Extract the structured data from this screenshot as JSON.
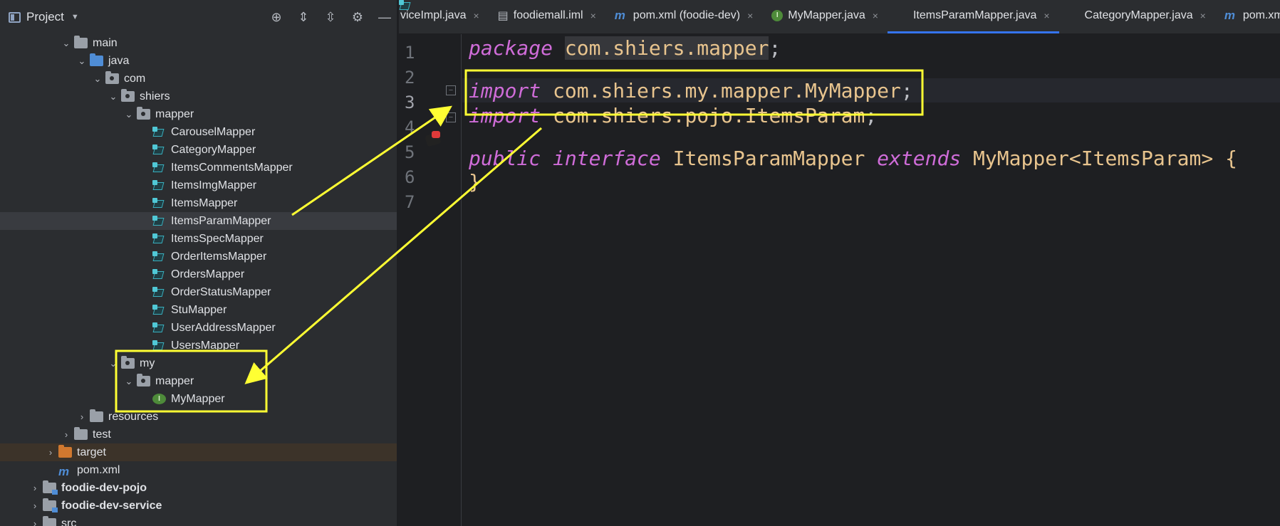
{
  "project_panel": {
    "title": "Project",
    "tree": [
      {
        "label": "main",
        "indent": 3,
        "expanded": true,
        "icon": "folder"
      },
      {
        "label": "java",
        "indent": 4,
        "expanded": true,
        "icon": "folder-blue"
      },
      {
        "label": "com",
        "indent": 5,
        "expanded": true,
        "icon": "package"
      },
      {
        "label": "shiers",
        "indent": 6,
        "expanded": true,
        "icon": "package"
      },
      {
        "label": "mapper",
        "indent": 7,
        "expanded": true,
        "icon": "package"
      },
      {
        "label": "CarouselMapper",
        "indent": 8,
        "icon": "mapper"
      },
      {
        "label": "CategoryMapper",
        "indent": 8,
        "icon": "mapper"
      },
      {
        "label": "ItemsCommentsMapper",
        "indent": 8,
        "icon": "mapper"
      },
      {
        "label": "ItemsImgMapper",
        "indent": 8,
        "icon": "mapper"
      },
      {
        "label": "ItemsMapper",
        "indent": 8,
        "icon": "mapper"
      },
      {
        "label": "ItemsParamMapper",
        "indent": 8,
        "icon": "mapper",
        "selected": true
      },
      {
        "label": "ItemsSpecMapper",
        "indent": 8,
        "icon": "mapper"
      },
      {
        "label": "OrderItemsMapper",
        "indent": 8,
        "icon": "mapper"
      },
      {
        "label": "OrdersMapper",
        "indent": 8,
        "icon": "mapper"
      },
      {
        "label": "OrderStatusMapper",
        "indent": 8,
        "icon": "mapper"
      },
      {
        "label": "StuMapper",
        "indent": 8,
        "icon": "mapper"
      },
      {
        "label": "UserAddressMapper",
        "indent": 8,
        "icon": "mapper"
      },
      {
        "label": "UsersMapper",
        "indent": 8,
        "icon": "mapper"
      },
      {
        "label": "my",
        "indent": 6,
        "expanded": true,
        "icon": "package"
      },
      {
        "label": "mapper",
        "indent": 7,
        "expanded": true,
        "icon": "package"
      },
      {
        "label": "MyMapper",
        "indent": 8,
        "icon": "interface"
      },
      {
        "label": "resources",
        "indent": 4,
        "collapsed": true,
        "icon": "folder"
      },
      {
        "label": "test",
        "indent": 3,
        "collapsed": true,
        "icon": "folder"
      },
      {
        "label": "target",
        "indent": 2,
        "collapsed": true,
        "icon": "folder-orange",
        "excluded": true
      },
      {
        "label": "pom.xml",
        "indent": 2,
        "icon": "maven"
      },
      {
        "label": "foodie-dev-pojo",
        "indent": 1,
        "collapsed": true,
        "icon": "module",
        "bold": true
      },
      {
        "label": "foodie-dev-service",
        "indent": 1,
        "collapsed": true,
        "icon": "module",
        "bold": true
      },
      {
        "label": "src",
        "indent": 1,
        "collapsed": true,
        "icon": "folder"
      }
    ]
  },
  "tabs": [
    {
      "label": "viceImpl.java",
      "icon": "none"
    },
    {
      "label": "foodiemall.iml",
      "icon": "file"
    },
    {
      "label": "pom.xml (foodie-dev)",
      "icon": "maven"
    },
    {
      "label": "MyMapper.java",
      "icon": "interface"
    },
    {
      "label": "ItemsParamMapper.java",
      "icon": "mapper",
      "active": true
    },
    {
      "label": "CategoryMapper.java",
      "icon": "mapper"
    },
    {
      "label": "pom.xml",
      "icon": "maven"
    }
  ],
  "editor": {
    "line_numbers": [
      "1",
      "2",
      "3",
      "4",
      "5",
      "6",
      "7"
    ],
    "line1": {
      "kw": "package",
      "pkg": "com.shiers.mapper",
      "end": ";"
    },
    "line3": {
      "kw": "import",
      "pkg": "com.shiers.my.mapper.MyMapper",
      "end": ";"
    },
    "line4": {
      "kw": "import",
      "pkg": "com.shiers.pojo.ItemsParam",
      "end": ";"
    },
    "line6": {
      "kw1": "public",
      "kw2": "interface",
      "name": "ItemsParamMapper",
      "kw3": "extends",
      "parent": "MyMapper<ItemsParam>",
      "brace": "{"
    },
    "line7": {
      "brace": "}"
    }
  },
  "annotation_color": "#ffff33"
}
